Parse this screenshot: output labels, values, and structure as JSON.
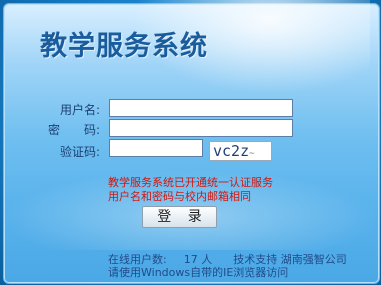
{
  "title": "教学服务系统",
  "form": {
    "username_label": "用户名:",
    "password_label": "密　　码:",
    "captcha_label": "验证码:",
    "username_value": "",
    "password_value": "",
    "captcha_value": "",
    "captcha_image_text": "vc2z"
  },
  "notice": {
    "line1": "教学服务系统已开通统一认证服务",
    "line2": "用户名和密码与校内邮箱相同"
  },
  "login_button": "登 录",
  "footer": {
    "online_label": "在线用户数:",
    "online_count": "17 人",
    "support": "技术支持 湖南强智公司",
    "browser_hint": "请使用Windows自带的IE浏览器访问"
  }
}
